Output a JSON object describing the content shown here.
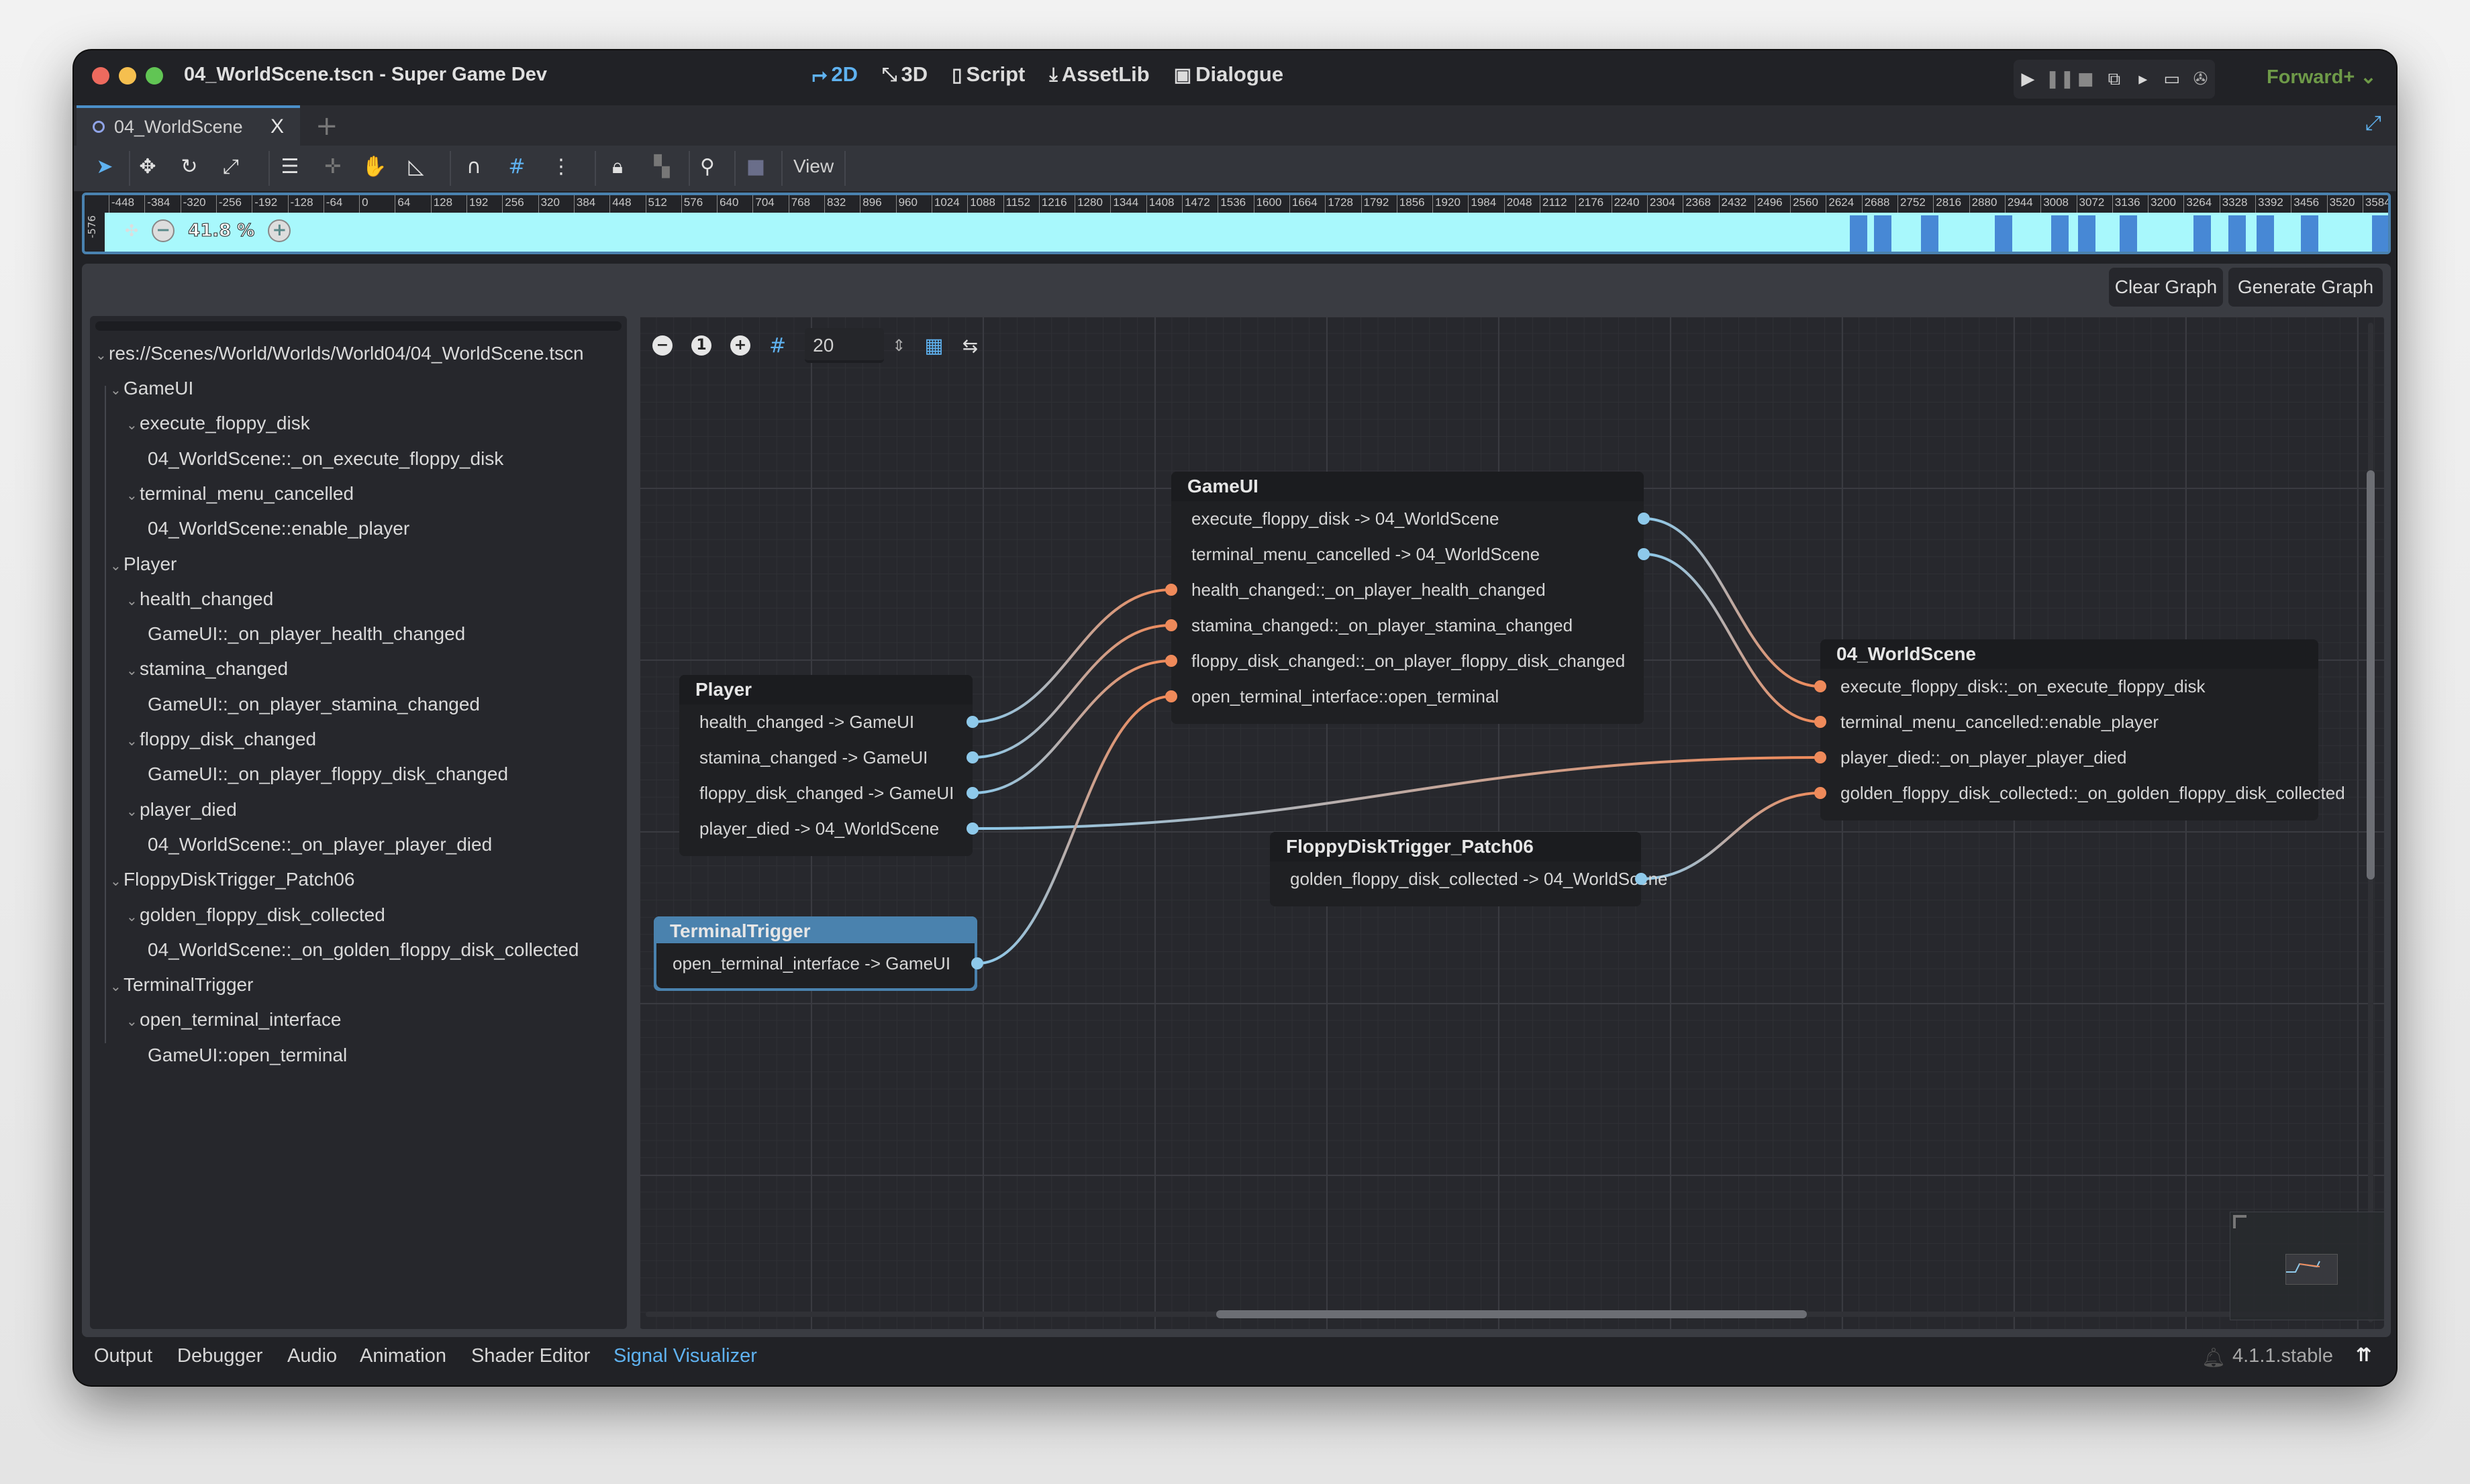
{
  "window": {
    "title": "04_WorldScene.tscn - Super Game Dev",
    "main_tabs": [
      {
        "label": "2D",
        "icon": "2d-icon",
        "active": true
      },
      {
        "label": "3D",
        "icon": "3d-icon",
        "active": false
      },
      {
        "label": "Script",
        "icon": "script-icon",
        "active": false
      },
      {
        "label": "AssetLib",
        "icon": "assetlib-icon",
        "active": false
      },
      {
        "label": "Dialogue",
        "icon": "dialogue-icon",
        "active": false
      }
    ],
    "run_controls": [
      "play-icon",
      "pause-icon",
      "stop-icon",
      "remote-debug-icon",
      "play-scene-icon",
      "play-custom-scene-icon",
      "movie-maker-icon"
    ],
    "renderer": "Forward+"
  },
  "scene_tabs": {
    "tabs": [
      {
        "label": "04_WorldScene"
      }
    ],
    "close_glyph": "X",
    "add_glyph": "+"
  },
  "toolbar": {
    "view_label": "View",
    "tools": [
      "select-icon",
      "move-icon",
      "rotate-icon",
      "scale-icon",
      "list-select-icon",
      "pivot-icon",
      "pan-icon",
      "ruler-icon",
      "smart-snap-icon",
      "grid-snap-icon",
      "more-icon",
      "lock-icon",
      "group-icon",
      "bone-icon",
      "camera-icon"
    ]
  },
  "viewport": {
    "zoom_label": "41.8 %",
    "ruler_ticks": [
      "-448",
      "-384",
      "-320",
      "-256",
      "-192",
      "-128",
      "-64",
      "0",
      "64",
      "128",
      "192",
      "256",
      "320",
      "384",
      "448",
      "512",
      "576",
      "640",
      "704",
      "768",
      "832",
      "896",
      "960",
      "1024",
      "1088",
      "1152",
      "1216",
      "1280",
      "1344",
      "1408",
      "1472",
      "1536",
      "1600",
      "1664",
      "1728",
      "1792",
      "1856",
      "1920",
      "1984",
      "2048",
      "2112",
      "2176",
      "2240",
      "2304",
      "2368",
      "2432",
      "2496",
      "2560",
      "2624",
      "2688",
      "2752",
      "2816",
      "2880",
      "2944",
      "3008",
      "3072",
      "3136",
      "3200",
      "3264",
      "3328",
      "3392",
      "3456",
      "3520",
      "3584"
    ],
    "vertical_ruler_label": "-576"
  },
  "panel": {
    "clear_graph_label": "Clear Graph",
    "generate_graph_label": "Generate Graph"
  },
  "tree": {
    "root": "res://Scenes/World/Worlds/World04/04_WorldScene.tscn",
    "rows": [
      {
        "level": 1,
        "label": "GameUI",
        "expandable": true
      },
      {
        "level": 2,
        "label": "execute_floppy_disk",
        "expandable": true
      },
      {
        "level": 3,
        "label": "04_WorldScene::_on_execute_floppy_disk",
        "expandable": false
      },
      {
        "level": 2,
        "label": "terminal_menu_cancelled",
        "expandable": true
      },
      {
        "level": 3,
        "label": "04_WorldScene::enable_player",
        "expandable": false
      },
      {
        "level": 1,
        "label": "Player",
        "expandable": true
      },
      {
        "level": 2,
        "label": "health_changed",
        "expandable": true
      },
      {
        "level": 3,
        "label": "GameUI::_on_player_health_changed",
        "expandable": false
      },
      {
        "level": 2,
        "label": "stamina_changed",
        "expandable": true
      },
      {
        "level": 3,
        "label": "GameUI::_on_player_stamina_changed",
        "expandable": false
      },
      {
        "level": 2,
        "label": "floppy_disk_changed",
        "expandable": true
      },
      {
        "level": 3,
        "label": "GameUI::_on_player_floppy_disk_changed",
        "expandable": false
      },
      {
        "level": 2,
        "label": "player_died",
        "expandable": true
      },
      {
        "level": 3,
        "label": "04_WorldScene::_on_player_player_died",
        "expandable": false
      },
      {
        "level": 1,
        "label": "FloppyDiskTrigger_Patch06",
        "expandable": true
      },
      {
        "level": 2,
        "label": "golden_floppy_disk_collected",
        "expandable": true
      },
      {
        "level": 3,
        "label": "04_WorldScene::_on_golden_floppy_disk_collected",
        "expandable": false
      },
      {
        "level": 1,
        "label": "TerminalTrigger",
        "expandable": true
      },
      {
        "level": 2,
        "label": "open_terminal_interface",
        "expandable": true
      },
      {
        "level": 3,
        "label": "GameUI::open_terminal",
        "expandable": false
      }
    ]
  },
  "graph": {
    "snap_value": "20",
    "colors": {
      "output_port": "#8ec9ea",
      "input_port": "#ef8a5a",
      "selected_node": "#4a82ae"
    },
    "nodes": {
      "player": {
        "title": "Player",
        "rows": [
          {
            "label": "health_changed -> GameUI",
            "port": "out"
          },
          {
            "label": "stamina_changed -> GameUI",
            "port": "out"
          },
          {
            "label": "floppy_disk_changed -> GameUI",
            "port": "out"
          },
          {
            "label": "player_died -> 04_WorldScene",
            "port": "out"
          }
        ]
      },
      "gameui": {
        "title": "GameUI",
        "rows": [
          {
            "label": "execute_floppy_disk -> 04_WorldScene",
            "port": "out"
          },
          {
            "label": "terminal_menu_cancelled -> 04_WorldScene",
            "port": "out"
          },
          {
            "label": "health_changed::_on_player_health_changed",
            "port": "in"
          },
          {
            "label": "stamina_changed::_on_player_stamina_changed",
            "port": "in"
          },
          {
            "label": "floppy_disk_changed::_on_player_floppy_disk_changed",
            "port": "in"
          },
          {
            "label": "open_terminal_interface::open_terminal",
            "port": "in"
          }
        ]
      },
      "worldscene": {
        "title": "04_WorldScene",
        "rows": [
          {
            "label": "execute_floppy_disk::_on_execute_floppy_disk",
            "port": "in"
          },
          {
            "label": "terminal_menu_cancelled::enable_player",
            "port": "in"
          },
          {
            "label": "player_died::_on_player_player_died",
            "port": "in"
          },
          {
            "label": "golden_floppy_disk_collected::_on_golden_floppy_disk_collected",
            "port": "in"
          }
        ]
      },
      "floppy": {
        "title": "FloppyDiskTrigger_Patch06",
        "rows": [
          {
            "label": "golden_floppy_disk_collected -> 04_WorldScene",
            "port": "out"
          }
        ]
      },
      "terminal": {
        "title": "TerminalTrigger",
        "selected": true,
        "rows": [
          {
            "label": "open_terminal_interface -> GameUI",
            "port": "out"
          }
        ]
      }
    },
    "connections": [
      {
        "from": "player.0",
        "to": "gameui.2"
      },
      {
        "from": "player.1",
        "to": "gameui.3"
      },
      {
        "from": "player.2",
        "to": "gameui.4"
      },
      {
        "from": "player.3",
        "to": "worldscene.2"
      },
      {
        "from": "terminal.0",
        "to": "gameui.5"
      },
      {
        "from": "gameui.0",
        "to": "worldscene.0"
      },
      {
        "from": "gameui.1",
        "to": "worldscene.1"
      },
      {
        "from": "floppy.0",
        "to": "worldscene.3"
      }
    ]
  },
  "bottom_bar": {
    "tabs": [
      {
        "label": "Output",
        "active": false
      },
      {
        "label": "Debugger",
        "active": false
      },
      {
        "label": "Audio",
        "active": false
      },
      {
        "label": "Animation",
        "active": false
      },
      {
        "label": "Shader Editor",
        "active": false
      },
      {
        "label": "Signal Visualizer",
        "active": true
      }
    ],
    "version": "4.1.1.stable"
  }
}
